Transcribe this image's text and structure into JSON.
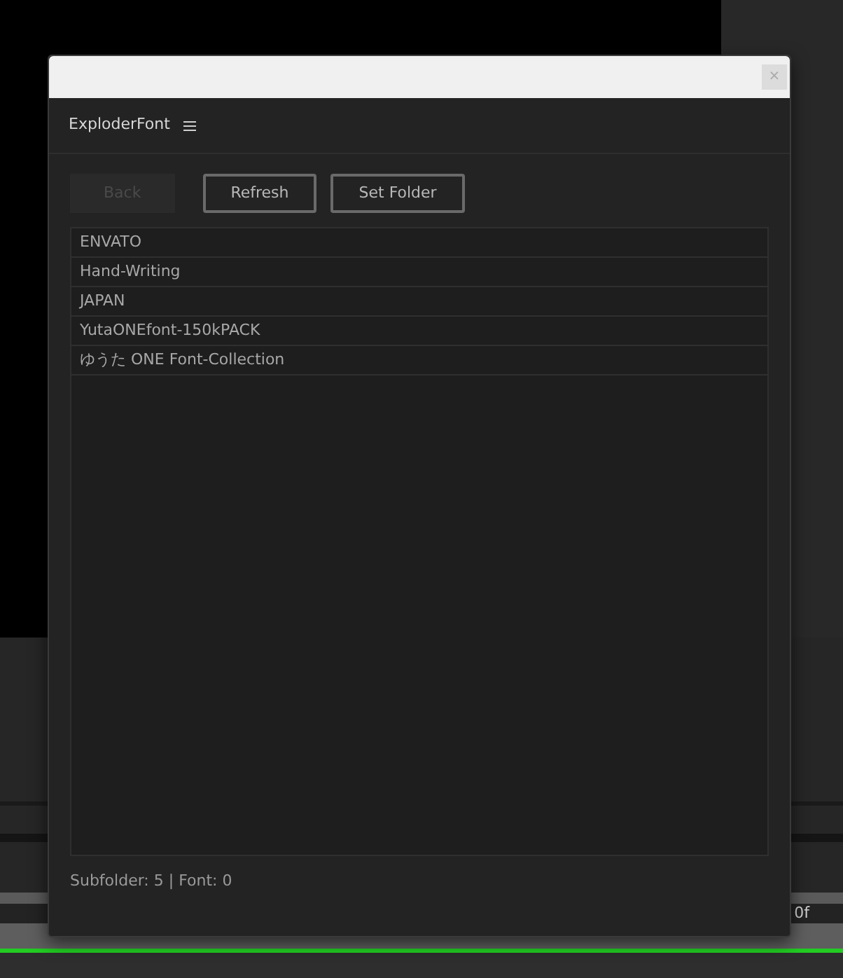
{
  "background": {
    "timecode": "0f"
  },
  "dialog": {
    "close": "×",
    "panel_title": "ExploderFont",
    "buttons": [
      {
        "label": "Back",
        "disabled": true
      },
      {
        "label": "Refresh",
        "disabled": false
      },
      {
        "label": "Set Folder",
        "disabled": false
      }
    ],
    "folders": [
      "ENVATO",
      "Hand-Writing",
      "JAPAN",
      "YutaONEfont-150kPACK",
      "ゆうた ONE Font-Collection"
    ],
    "status": "Subfolder: 5 | Font: 0"
  }
}
